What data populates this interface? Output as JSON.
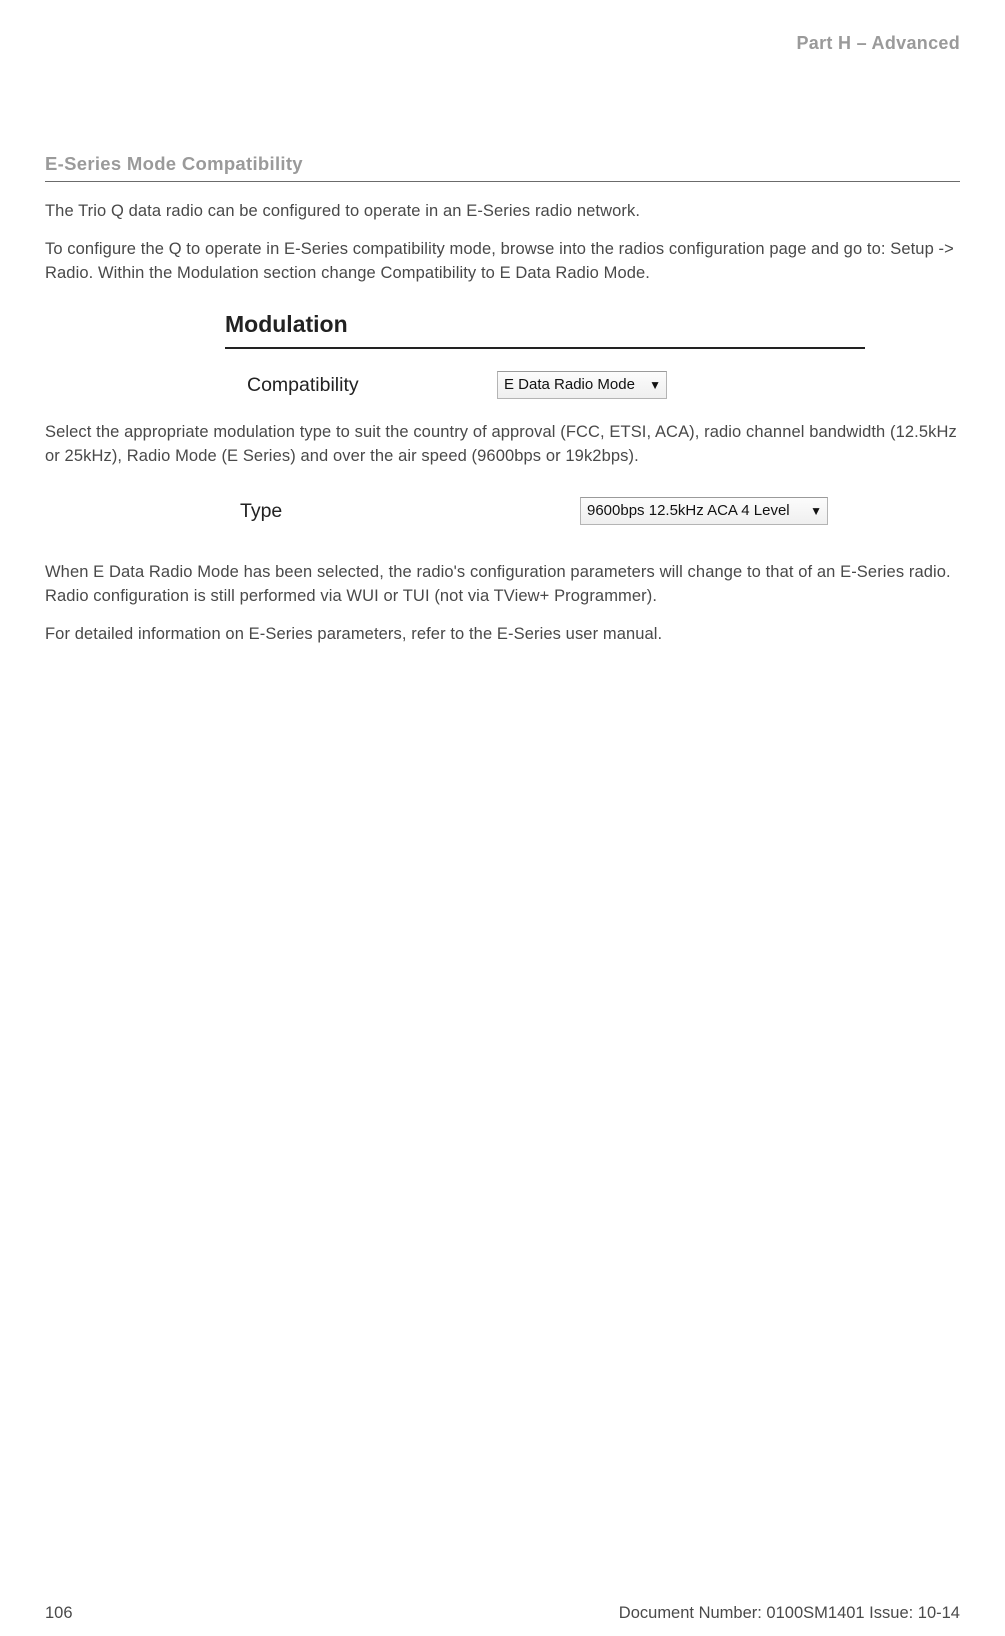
{
  "header": {
    "section_label": "Part H – Advanced"
  },
  "section": {
    "title": "E-Series Mode Compatibility",
    "para1": "The Trio Q data radio can be configured to operate in an E-Series radio network.",
    "para2": "To configure the Q to operate in E-Series compatibility mode, browse into the radios configuration page and go to: Setup -> Radio. Within the Modulation section change Compatibility to E Data Radio Mode.",
    "para3": "Select the appropriate modulation type to suit the country of approval (FCC, ETSI, ACA), radio channel bandwidth (12.5kHz or 25kHz), Radio Mode (E Series) and over the air speed (9600bps or 19k2bps).",
    "para4": "When E Data Radio Mode has been selected, the radio's configuration parameters will change to that of an E-Series radio. Radio configuration is still performed via WUI or TUI (not via TView+ Programmer).",
    "para5": "For detailed information on E-Series parameters, refer to the E-Series user manual."
  },
  "figure_modulation": {
    "group_title": "Modulation",
    "row_label": "Compatibility",
    "dropdown_value": "E Data Radio Mode"
  },
  "figure_type": {
    "row_label": "Type",
    "dropdown_value": "9600bps 12.5kHz ACA 4 Level"
  },
  "footer": {
    "page_number": "106",
    "doc_info": "Document Number: 0100SM1401   Issue: 10-14"
  }
}
